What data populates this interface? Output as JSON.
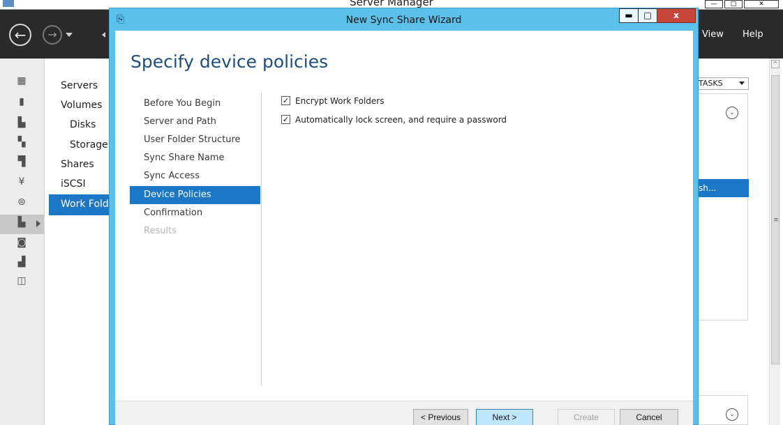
{
  "server_manager": {
    "title": "Server Manager",
    "window_controls": {
      "minimize": "—",
      "maximize": "□",
      "close": "✕"
    },
    "menu": {
      "view": "View",
      "help": "Help"
    },
    "nav": {
      "servers": "Servers",
      "volumes": "Volumes",
      "disks": "Disks",
      "storage": "Storage",
      "shares": "Shares",
      "iscsi": "iSCSI",
      "work_folders": "Work Fold"
    },
    "tasks_label": "TASKS",
    "selected_row_text": "sh..."
  },
  "wizard": {
    "title": "New Sync Share Wizard",
    "heading": "Specify device policies",
    "window_controls": {
      "minimize": "▬",
      "maximize": "□",
      "close": "x"
    },
    "steps": [
      {
        "label": "Before You Begin",
        "state": "normal"
      },
      {
        "label": "Server and Path",
        "state": "normal"
      },
      {
        "label": "User Folder Structure",
        "state": "normal"
      },
      {
        "label": "Sync Share Name",
        "state": "normal"
      },
      {
        "label": "Sync Access",
        "state": "normal"
      },
      {
        "label": "Device Policies",
        "state": "active"
      },
      {
        "label": "Confirmation",
        "state": "normal"
      },
      {
        "label": "Results",
        "state": "disabled"
      }
    ],
    "options": {
      "encrypt": {
        "label": "Encrypt Work Folders",
        "checked": true
      },
      "autolock": {
        "label": "Automatically lock screen, and require a password",
        "checked": true
      }
    },
    "buttons": {
      "previous": "< Previous",
      "next": "Next >",
      "create": "Create",
      "cancel": "Cancel"
    }
  },
  "colors": {
    "wizard_frame": "#5bc1eb",
    "selection_blue": "#1c78c6",
    "heading_blue": "#1d4e7e",
    "header_dark": "#2a2a2a"
  }
}
